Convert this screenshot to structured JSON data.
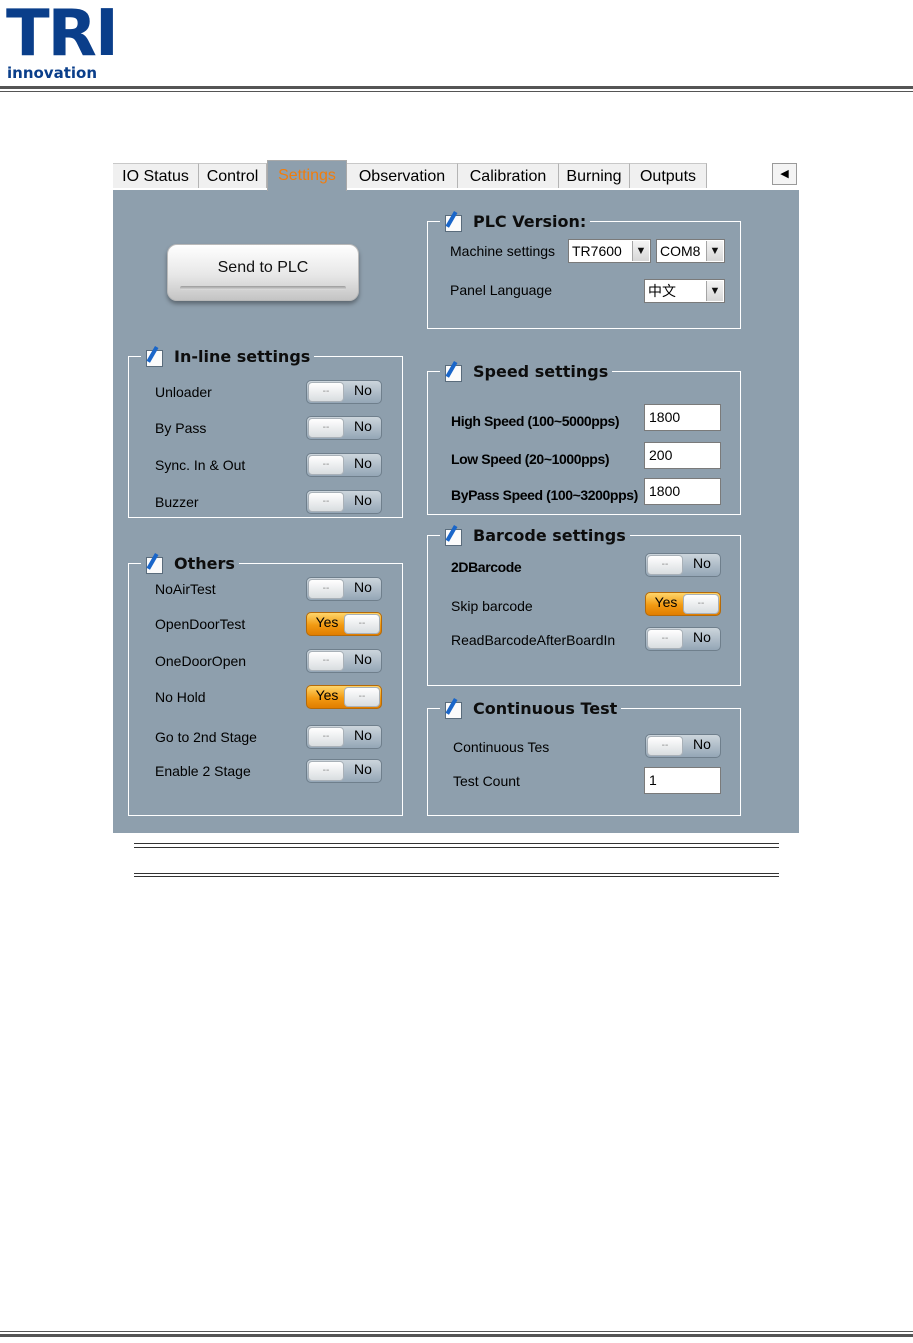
{
  "header": {
    "logo_text": "TRI",
    "logo_sub": "innovation"
  },
  "tabs": [
    {
      "label": "IO Status"
    },
    {
      "label": "Control"
    },
    {
      "label": "Settings"
    },
    {
      "label": "Observation"
    },
    {
      "label": "Calibration"
    },
    {
      "label": "Burning"
    },
    {
      "label": "Outputs"
    }
  ],
  "active_tab": "Settings",
  "colors": {
    "panel": "#8e9fad",
    "active_tab_text": "#f27d0c",
    "toggle_on": "#f29a12",
    "logo": "#0a3e8a"
  },
  "send_button": {
    "label": "Send to PLC"
  },
  "plc_version": {
    "title": "PLC Version:",
    "machine_label": "Machine settings",
    "machine_value": "TR7600",
    "port_value": "COM8",
    "language_label": "Panel Language",
    "language_value": "中文"
  },
  "inline_settings": {
    "title": "In-line settings",
    "items": [
      {
        "label": "Unloader",
        "state": "No"
      },
      {
        "label": "By Pass",
        "state": "No"
      },
      {
        "label": "Sync. In & Out",
        "state": "No"
      },
      {
        "label": "Buzzer",
        "state": "No"
      }
    ]
  },
  "others": {
    "title": "Others",
    "items": [
      {
        "label": "NoAirTest",
        "state": "No"
      },
      {
        "label": "OpenDoorTest",
        "state": "Yes"
      },
      {
        "label": "OneDoorOpen",
        "state": "No"
      },
      {
        "label": "No Hold",
        "state": "Yes"
      },
      {
        "label": "Go to 2nd Stage",
        "state": "No"
      },
      {
        "label": "Enable 2 Stage",
        "state": "No"
      }
    ]
  },
  "speed_settings": {
    "title": "Speed settings",
    "items": [
      {
        "label": "High Speed (100~5000pps)",
        "value": "1800"
      },
      {
        "label": "Low Speed (20~1000pps)",
        "value": "200"
      },
      {
        "label": "ByPass Speed (100~3200pps)",
        "value": "1800"
      }
    ]
  },
  "barcode_settings": {
    "title": "Barcode settings",
    "items": [
      {
        "label": "2DBarcode",
        "state": "No"
      },
      {
        "label": "Skip barcode",
        "state": "Yes"
      },
      {
        "label": "ReadBarcodeAfterBoardIn",
        "state": "No"
      }
    ]
  },
  "continuous_test": {
    "title": "Continuous Test",
    "toggle_label": "Continuous Tes",
    "toggle_state": "No",
    "count_label": "Test Count",
    "count_value": "1"
  },
  "toggle_knob_text": "--"
}
